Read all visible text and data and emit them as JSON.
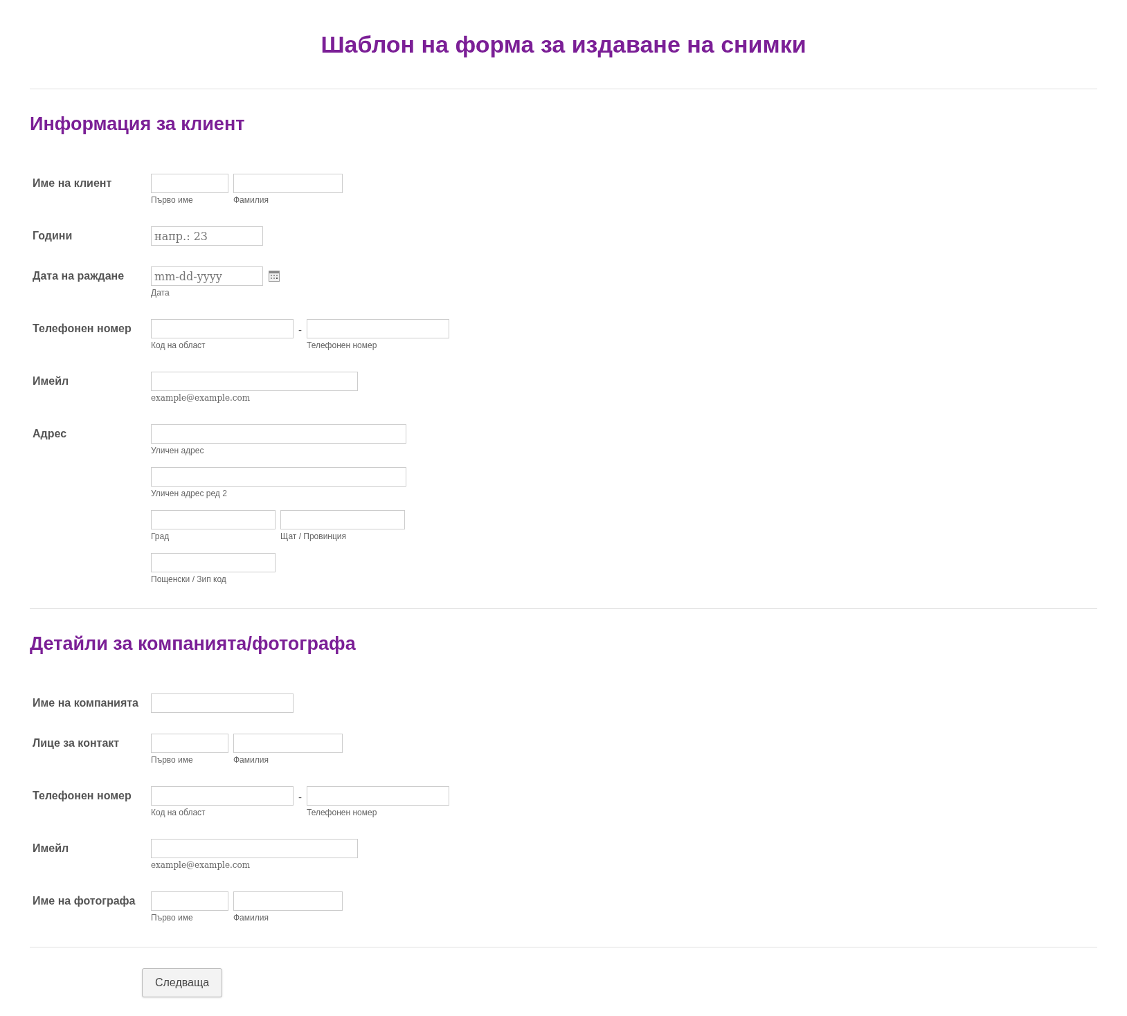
{
  "title": "Шаблон на форма за издаване на снимки",
  "sections": [
    {
      "heading": "Информация за клиент",
      "fields": [
        {
          "label": "Име на клиент",
          "kind": "name",
          "inputs": [
            {
              "sublabel": "Първо име"
            },
            {
              "sublabel": "Фамилия"
            }
          ]
        },
        {
          "label": "Години",
          "kind": "number",
          "inputs": [
            {
              "placeholder": "напр.: 23"
            }
          ]
        },
        {
          "label": "Дата на раждане",
          "kind": "date",
          "inputs": [
            {
              "placeholder": "mm-dd-yyyy",
              "sublabel": "Дата"
            }
          ]
        },
        {
          "label": "Телефонен номер",
          "kind": "phone",
          "separator": "-",
          "inputs": [
            {
              "sublabel": "Код на област"
            },
            {
              "sublabel": "Телефонен номер"
            }
          ]
        },
        {
          "label": "Имейл",
          "kind": "email",
          "inputs": [
            {
              "sublabel": "example@example.com"
            }
          ]
        },
        {
          "label": "Адрес",
          "kind": "address",
          "inputs": [
            {
              "sublabel": "Уличен адрес"
            },
            {
              "sublabel": "Уличен адрес ред 2"
            },
            {
              "sublabel": "Град"
            },
            {
              "sublabel": "Щат / Провинция"
            },
            {
              "sublabel": "Пощенски / Зип код"
            }
          ]
        }
      ]
    },
    {
      "heading": "Детайли за компанията/фотографа",
      "fields": [
        {
          "label": "Име на компанията",
          "kind": "text"
        },
        {
          "label": "Лице за контакт",
          "kind": "name",
          "inputs": [
            {
              "sublabel": "Първо име"
            },
            {
              "sublabel": "Фамилия"
            }
          ]
        },
        {
          "label": "Телефонен номер",
          "kind": "phone",
          "separator": "-",
          "inputs": [
            {
              "sublabel": "Код на област"
            },
            {
              "sublabel": "Телефонен номер"
            }
          ]
        },
        {
          "label": "Имейл",
          "kind": "email",
          "inputs": [
            {
              "sublabel": "example@example.com"
            }
          ]
        },
        {
          "label": "Име на фотографа",
          "kind": "name",
          "inputs": [
            {
              "sublabel": "Първо име"
            },
            {
              "sublabel": "Фамилия"
            }
          ]
        }
      ]
    }
  ],
  "button": {
    "label": "Следваща"
  }
}
